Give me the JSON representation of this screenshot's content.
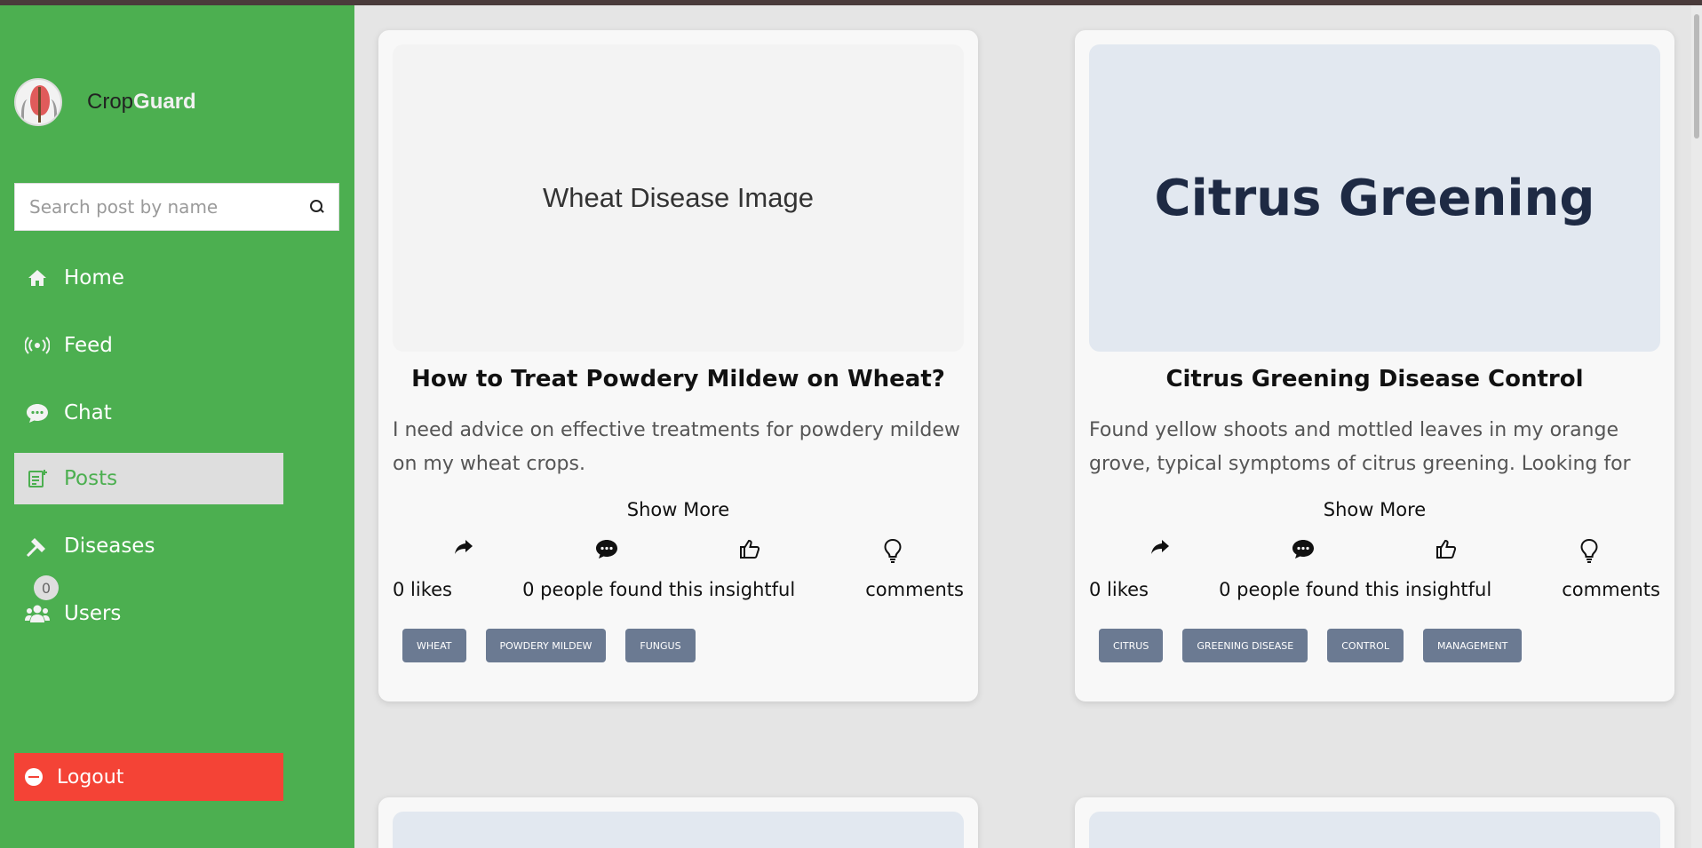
{
  "app": {
    "name_plain": "Crop",
    "name_accent": "Guard"
  },
  "search": {
    "placeholder": "Search post by name"
  },
  "nav": [
    {
      "label": "Home",
      "icon": "home-icon"
    },
    {
      "label": "Feed",
      "icon": "broadcast-icon"
    },
    {
      "label": "Chat",
      "icon": "chat-icon"
    },
    {
      "label": "Posts",
      "icon": "post-icon",
      "active": true
    },
    {
      "label": "Diseases",
      "icon": "disease-icon"
    },
    {
      "label": "Users",
      "icon": "users-icon",
      "badge": "0"
    }
  ],
  "logout": {
    "label": "Logout"
  },
  "posts": [
    {
      "image_text": "Wheat Disease Image",
      "title": "How to Treat Powdery Mildew on Wheat?",
      "description": "I need advice on effective treatments for powdery mildew on my wheat crops.",
      "show_more": "Show More",
      "likes": "0 likes",
      "insightful": "0 people found this insightful",
      "comments": "comments",
      "tags": [
        "WHEAT",
        "POWDERY MILDEW",
        "FUNGUS"
      ]
    },
    {
      "image_text": "Citrus Greening",
      "title": "Citrus Greening Disease Control",
      "description": "Found yellow shoots and mottled leaves in my orange grove, typical symptoms of citrus greening. Looking for both...",
      "show_more": "Show More",
      "likes": "0 likes",
      "insightful": "0 people found this insightful",
      "comments": "comments",
      "tags": [
        "CITRUS",
        "GREENING DISEASE",
        "CONTROL",
        "MANAGEMENT"
      ]
    }
  ],
  "colors": {
    "sidebar": "#4caf50",
    "active_nav_bg": "#dedede",
    "logout": "#f44336",
    "tag": "#6b7a92",
    "page_bg": "#e5e5e5"
  }
}
